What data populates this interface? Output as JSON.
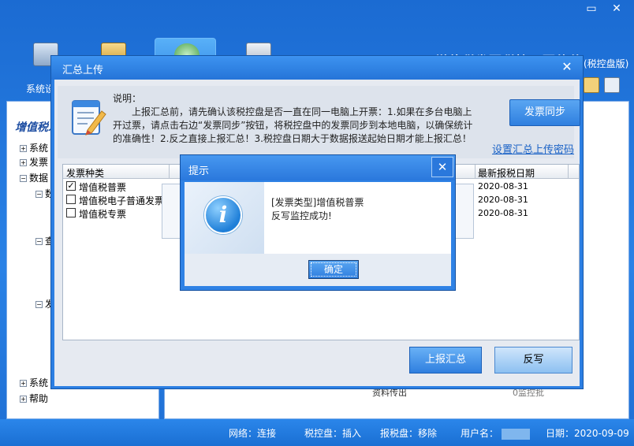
{
  "background": {
    "brand_title": "增值税发票税控开票软件",
    "brand_sub": "(税控盘版)",
    "toolbar": {
      "system_settings_label": "系统设置"
    },
    "sidebar": {
      "title": "增值税发",
      "items": [
        {
          "label": "系统"
        },
        {
          "label": "发票"
        },
        {
          "label": "数据"
        },
        {
          "label": "数"
        },
        {
          "label": "查"
        },
        {
          "label": "发"
        },
        {
          "label": "系统"
        },
        {
          "label": "帮助"
        }
      ]
    },
    "partial_texts": [
      "资料传出",
      "0监控批"
    ]
  },
  "status_bar": {
    "network": "网络：连接",
    "tax_disk": "税控盘：插入",
    "report_disk": "报税盘：移除",
    "user_label": "用户名：",
    "date": "日期：2020-09-09"
  },
  "summary_dialog": {
    "title": "汇总上传",
    "close_glyph": "✕",
    "info_heading": "说明：",
    "info_content": "上报汇总前，请先确认该税控盘是否一直在同一电脑上开票：1.如果在多台电脑上开过票，请点击右边“发票同步”按钮，将税控盘中的发票同步到本地电脑，以确保统计的准确性！2.反之直接上报汇总！3.税控盘日期大于数据报送起始日期才能上报汇总！",
    "sync_button": "发票同步",
    "set_password_link": "设置汇总上传密码",
    "table": {
      "col_type": "发票种类",
      "col_date": "最新报税日期",
      "rows": [
        {
          "type": "增值税普票",
          "checked": true,
          "check_glyph": "✓",
          "date": "2020-08-31"
        },
        {
          "type": "增值税电子普通发票",
          "checked": false,
          "check_glyph": "",
          "date": "2020-08-31"
        },
        {
          "type": "增值税专票",
          "checked": false,
          "check_glyph": "",
          "date": "2020-08-31"
        }
      ]
    },
    "upload_button": "上报汇总",
    "reverse_button": "反写"
  },
  "prompt_dialog": {
    "title": "提示",
    "close_glyph": "✕",
    "icon_glyph": "i",
    "message_line1": "[发票类型]增值税普票",
    "message_line2": "反写监控成功!",
    "ok_button": "确定"
  }
}
